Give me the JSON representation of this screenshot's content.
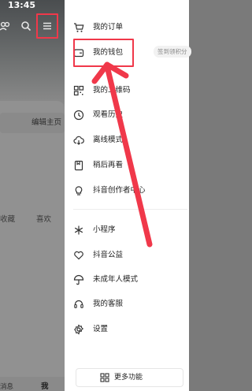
{
  "status_bar": {
    "time": "13:45"
  },
  "profile": {
    "edit_profile_label": "编辑主页",
    "tabs": {
      "favorites": "收藏",
      "likes": "喜欢"
    },
    "bottom_nav": {
      "messages": "消息",
      "me": "我"
    }
  },
  "drawer": {
    "items_top": [
      {
        "label": "我的订单",
        "icon": "cart-icon"
      },
      {
        "label": "我的钱包",
        "icon": "wallet-icon"
      },
      {
        "label": "我的二维码",
        "icon": "qrcode-icon"
      },
      {
        "label": "观看历史",
        "icon": "clock-icon"
      },
      {
        "label": "离线模式",
        "icon": "cloud-download-icon"
      },
      {
        "label": "稍后再看",
        "icon": "bookmark-icon"
      },
      {
        "label": "抖音创作者中心",
        "icon": "lightbulb-icon"
      }
    ],
    "wallet_badge": "签到领积分",
    "items_bottom": [
      {
        "label": "小程序",
        "icon": "asterisk-icon"
      },
      {
        "label": "抖音公益",
        "icon": "charity-icon"
      },
      {
        "label": "未成年人模式",
        "icon": "umbrella-icon"
      },
      {
        "label": "我的客服",
        "icon": "headset-icon"
      },
      {
        "label": "设置",
        "icon": "gear-icon"
      }
    ],
    "more_features": "更多功能"
  },
  "colors": {
    "highlight": "#f0384a",
    "drawer_bg": "#ffffff",
    "overlay": "#8c8c8c"
  }
}
